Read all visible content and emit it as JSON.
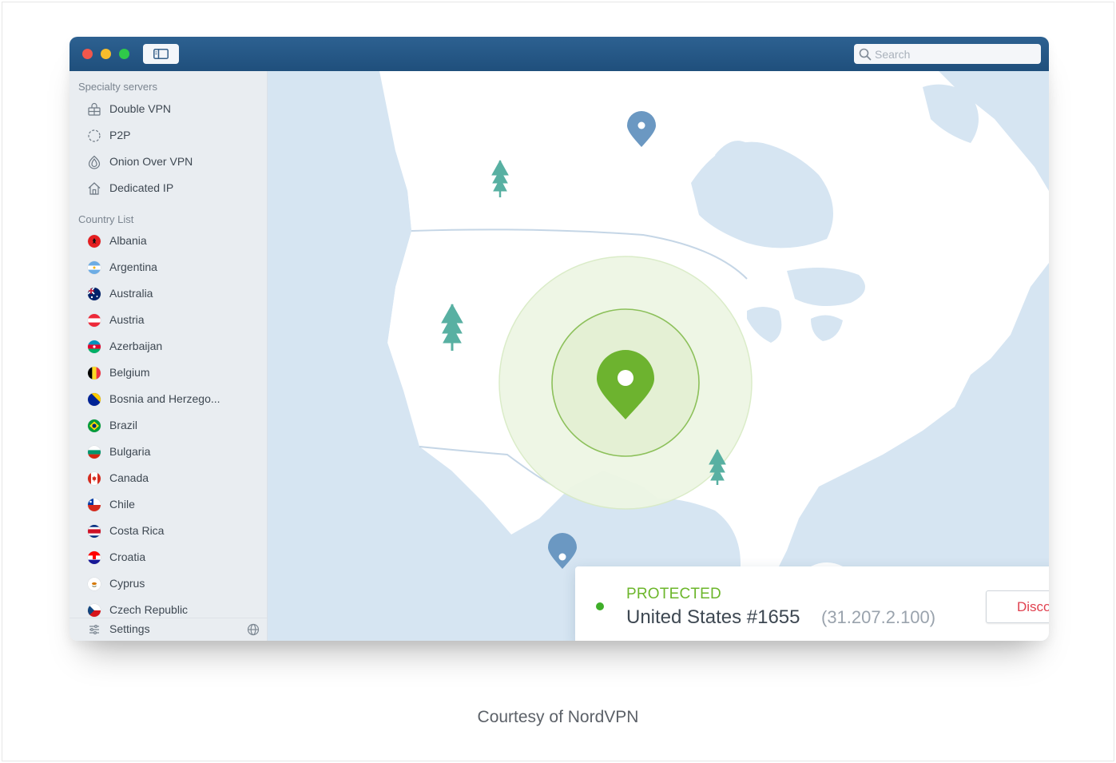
{
  "window": {
    "search_placeholder": "Search"
  },
  "sidebar": {
    "specialty_title": "Specialty servers",
    "specialty": [
      {
        "label": "Double VPN",
        "icon": "double-vpn-icon"
      },
      {
        "label": "P2P",
        "icon": "p2p-icon"
      },
      {
        "label": "Onion Over VPN",
        "icon": "onion-icon"
      },
      {
        "label": "Dedicated IP",
        "icon": "dedicated-ip-icon"
      }
    ],
    "country_title": "Country List",
    "countries": [
      {
        "label": "Albania",
        "flag": "albania"
      },
      {
        "label": "Argentina",
        "flag": "argentina"
      },
      {
        "label": "Australia",
        "flag": "australia"
      },
      {
        "label": "Austria",
        "flag": "austria"
      },
      {
        "label": "Azerbaijan",
        "flag": "azerbaijan"
      },
      {
        "label": "Belgium",
        "flag": "belgium"
      },
      {
        "label": "Bosnia and Herzego...",
        "flag": "bosnia"
      },
      {
        "label": "Brazil",
        "flag": "brazil"
      },
      {
        "label": "Bulgaria",
        "flag": "bulgaria"
      },
      {
        "label": "Canada",
        "flag": "canada"
      },
      {
        "label": "Chile",
        "flag": "chile"
      },
      {
        "label": "Costa Rica",
        "flag": "costa-rica"
      },
      {
        "label": "Croatia",
        "flag": "croatia"
      },
      {
        "label": "Cyprus",
        "flag": "cyprus"
      },
      {
        "label": "Czech Republic",
        "flag": "czech"
      }
    ],
    "settings_label": "Settings"
  },
  "status": {
    "state": "PROTECTED",
    "server": "United States #1655",
    "ip": "(31.207.2.100)",
    "disconnect_label": "Disconnect"
  },
  "caption": "Courtesy of NordVPN",
  "colors": {
    "titlebar": "#245684",
    "accent_green": "#6cb62b",
    "disconnect_red": "#e0414f",
    "map_water": "#d6e5f2",
    "map_land": "#ffffff"
  }
}
